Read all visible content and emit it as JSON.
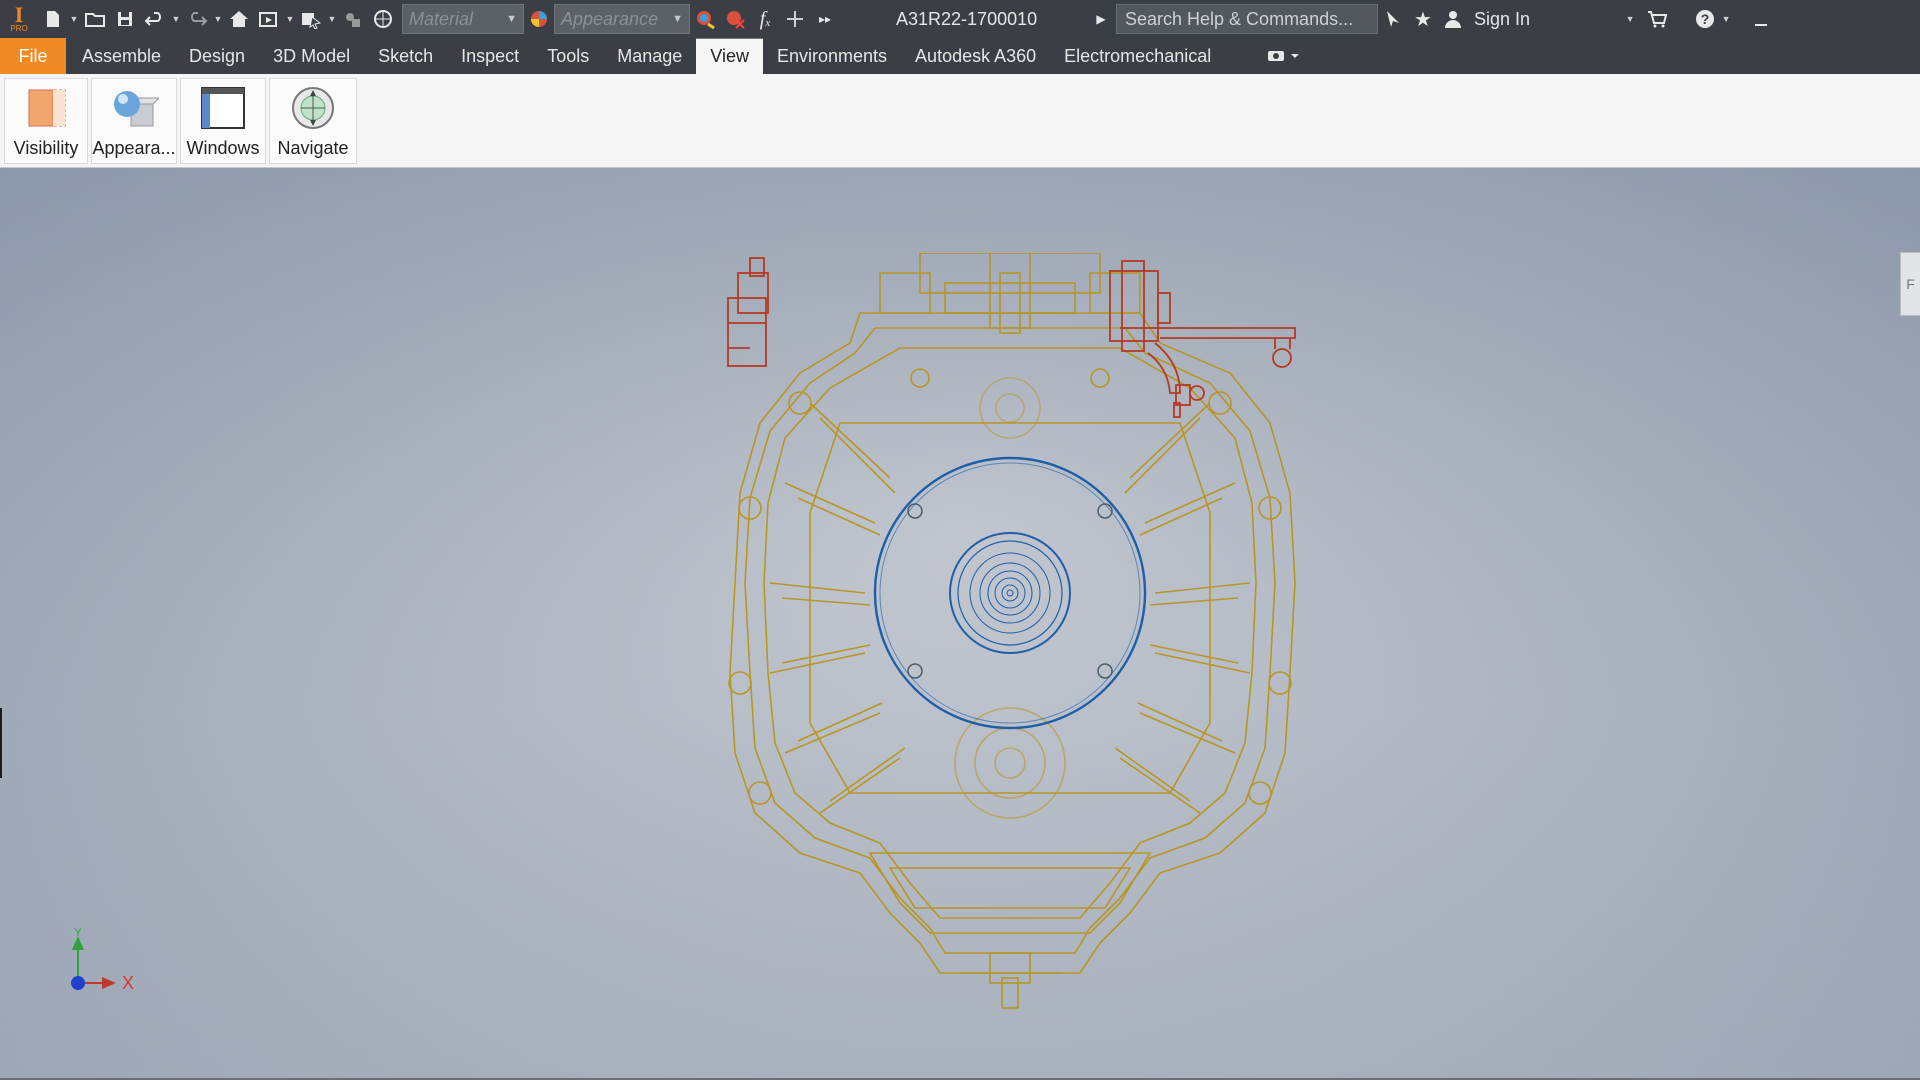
{
  "app": {
    "logo_letter": "I",
    "logo_sub": "PRO"
  },
  "qat": {
    "material_placeholder": "Material",
    "appearance_placeholder": "Appearance",
    "doc_title": "A31R22-1700010",
    "search_placeholder": "Search Help & Commands...",
    "sign_in": "Sign In",
    "fx": "f"
  },
  "tabs": [
    {
      "label": "File"
    },
    {
      "label": "Assemble"
    },
    {
      "label": "Design"
    },
    {
      "label": "3D Model"
    },
    {
      "label": "Sketch"
    },
    {
      "label": "Inspect"
    },
    {
      "label": "Tools"
    },
    {
      "label": "Manage"
    },
    {
      "label": "View",
      "active": true
    },
    {
      "label": "Environments"
    },
    {
      "label": "Autodesk A360"
    },
    {
      "label": "Electromechanical"
    }
  ],
  "ribbon": {
    "buttons": [
      {
        "label": "Visibility",
        "icon": "visibility-icon"
      },
      {
        "label": "Appeara...",
        "icon": "appearance-icon"
      },
      {
        "label": "Windows",
        "icon": "windows-icon"
      },
      {
        "label": "Navigate",
        "icon": "navigate-icon"
      }
    ]
  },
  "viewport": {
    "triad": {
      "x_label": "X",
      "y_label": "Y"
    },
    "side_tab": "F"
  },
  "colors": {
    "accent": "#f08a24",
    "titlebar": "#3b3f45",
    "wire_gold": "#b8941c",
    "wire_red": "#b43a22",
    "wire_blue": "#1e5fa8"
  }
}
